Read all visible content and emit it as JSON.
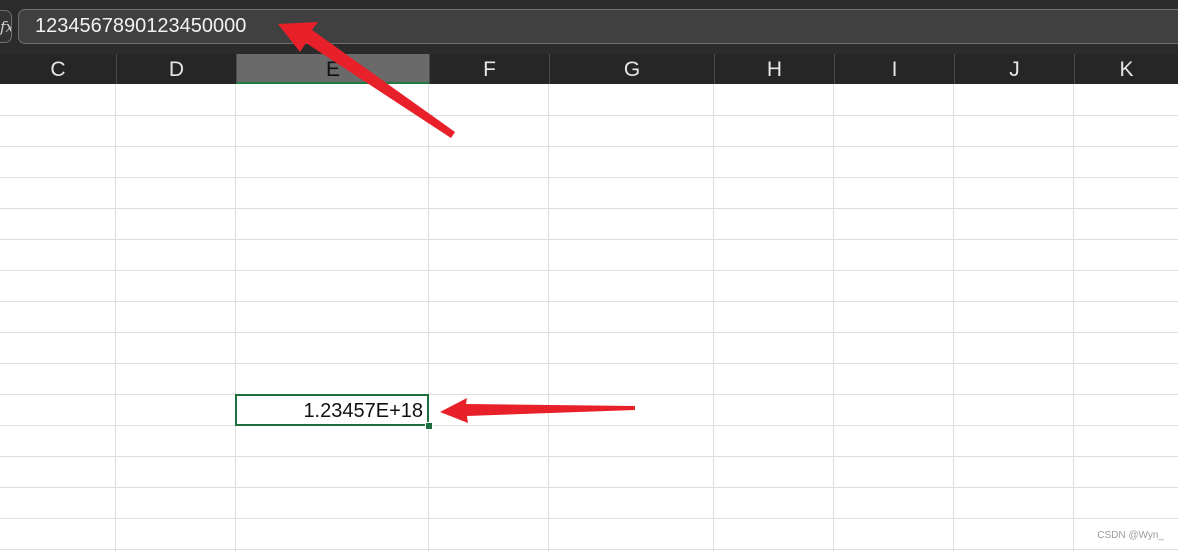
{
  "formula_bar": {
    "fx_label": "fx",
    "value": "1234567890123450000"
  },
  "columns": [
    {
      "label": "C",
      "selected": false
    },
    {
      "label": "D",
      "selected": false
    },
    {
      "label": "E",
      "selected": true
    },
    {
      "label": "F",
      "selected": false
    },
    {
      "label": "G",
      "selected": false
    },
    {
      "label": "H",
      "selected": false
    },
    {
      "label": "I",
      "selected": false
    },
    {
      "label": "J",
      "selected": false
    },
    {
      "label": "K",
      "selected": false
    }
  ],
  "active_cell": {
    "column": "E",
    "display_value": "1.23457E+18"
  },
  "colors": {
    "selection_border": "#1d6f3f",
    "annotation_arrow": "#e8202a",
    "header_background": "#262626"
  },
  "watermark": "CSDN @Wyn_"
}
